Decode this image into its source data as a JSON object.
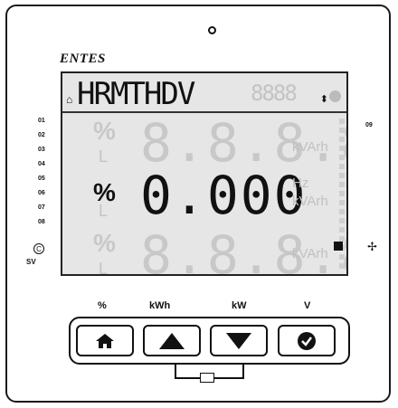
{
  "brand": "ENTES",
  "display": {
    "mode_text": "HRMTHDV",
    "ghost_top": "8888",
    "ghost_symbols": "?⌂",
    "updown_symbol": "⬍",
    "row1": {
      "unit_symbol": "%",
      "value": "8.8.8.8",
      "unit": "kVArh"
    },
    "row2": {
      "unit_symbol": "%",
      "value": "0.000",
      "unit": "Hz",
      "unit2": "kVArh"
    },
    "row3": {
      "unit_symbol": "%",
      "value": "8.8.8.8",
      "unit": "kVArh"
    },
    "L_label": "L"
  },
  "step_labels": [
    "01",
    "02",
    "03",
    "04",
    "05",
    "06",
    "07",
    "08"
  ],
  "step_right": "09",
  "c_symbol": "C",
  "sv_text": "SV",
  "fan_symbol": "⚓",
  "keys": [
    {
      "label": "%",
      "icon": "home-icon"
    },
    {
      "label": "kWh",
      "icon": "up-arrow-icon"
    },
    {
      "label": "kW",
      "icon": "down-arrow-icon"
    },
    {
      "label": "V",
      "icon": "check-icon"
    }
  ]
}
